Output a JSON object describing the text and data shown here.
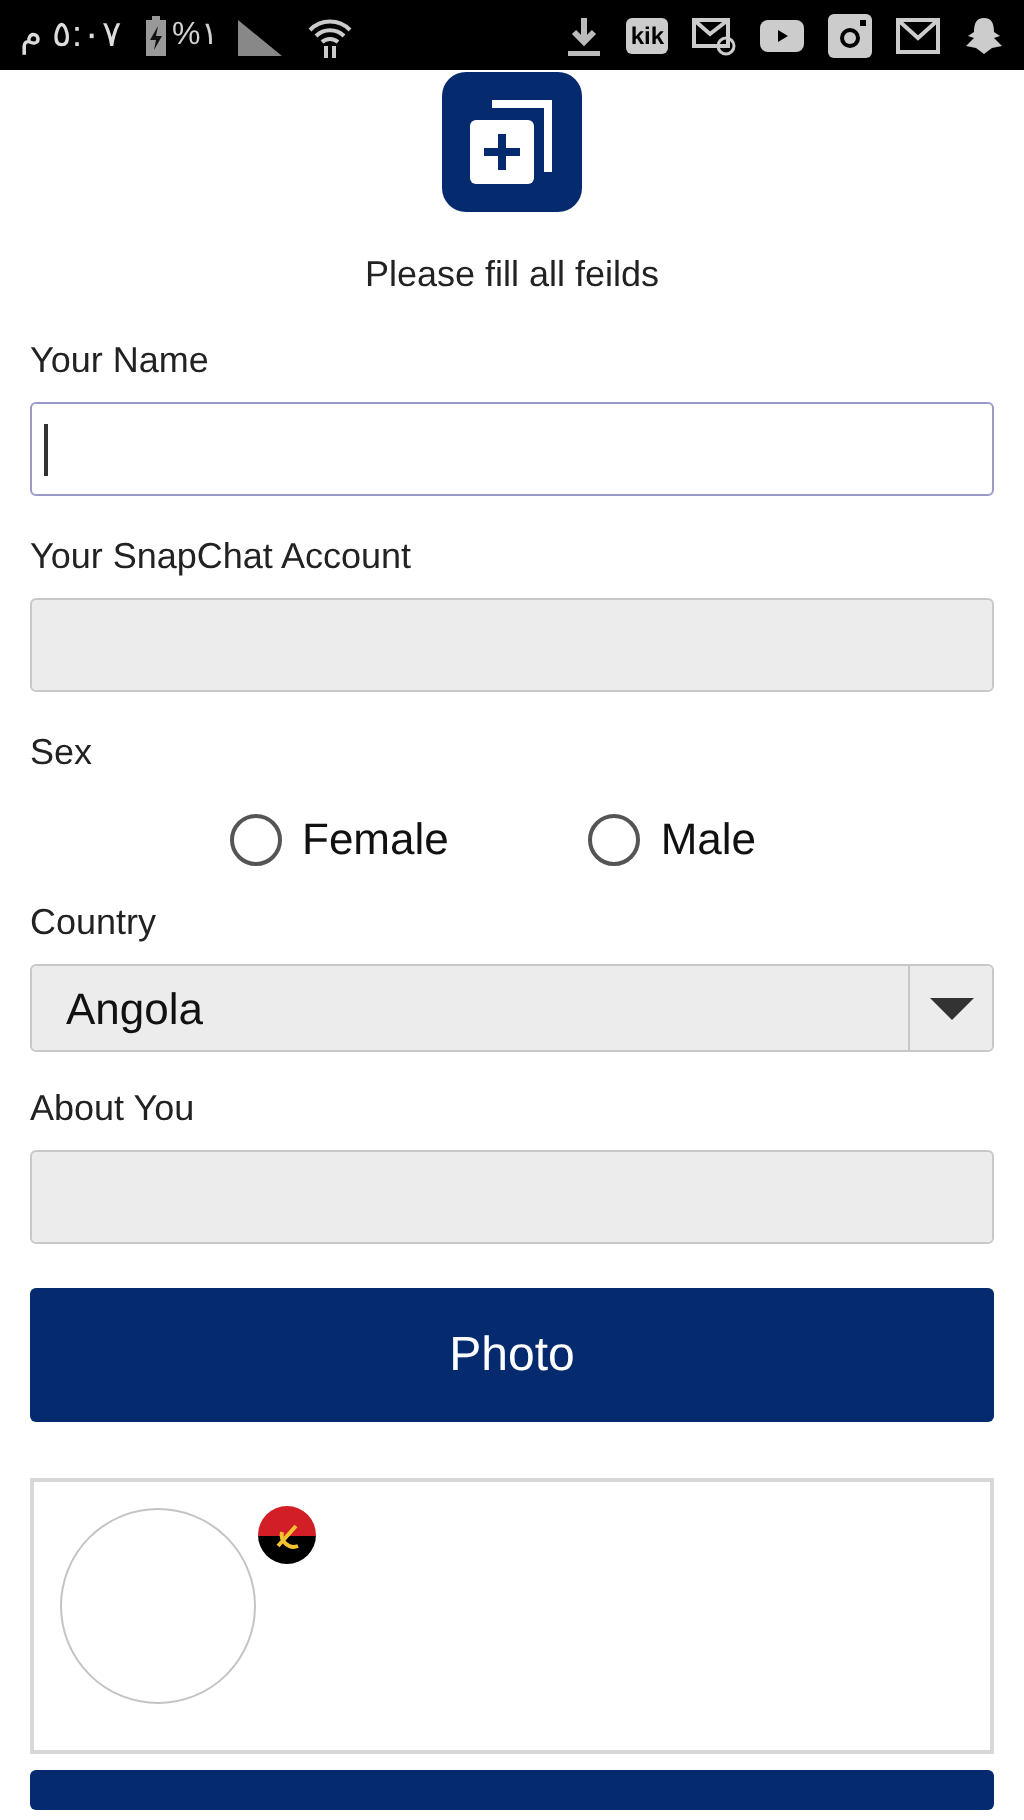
{
  "status_bar": {
    "time": "٥:٠٧ م",
    "battery": "%١",
    "kik": "kik"
  },
  "form": {
    "intro": "Please fill all feilds",
    "fields": [
      {
        "kind": "text",
        "label": "Your Name",
        "focused": true
      },
      {
        "kind": "text",
        "label": "Your SnapChat Account",
        "focused": false
      },
      {
        "kind": "radio",
        "label": "Sex",
        "options": [
          {
            "label": "Female",
            "selected": false
          },
          {
            "label": "Male",
            "selected": false
          }
        ]
      },
      {
        "kind": "select",
        "label": "Country",
        "value": "Angola"
      },
      {
        "kind": "text",
        "label": "About You",
        "focused": false
      }
    ],
    "photo_button": "Photo"
  }
}
